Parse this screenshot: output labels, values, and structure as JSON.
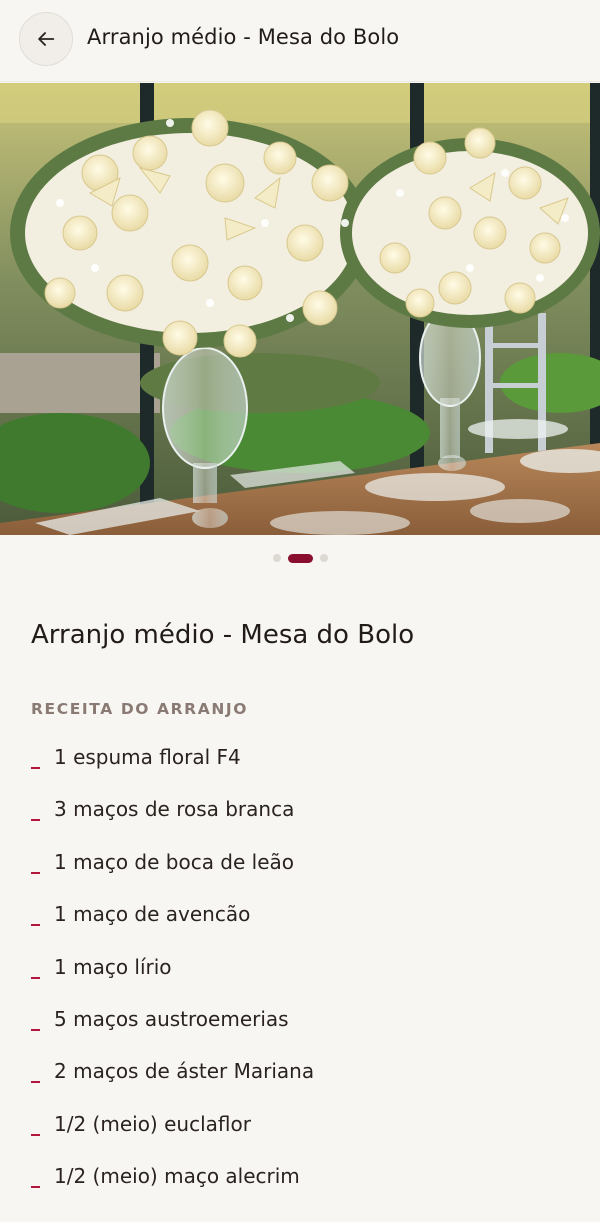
{
  "header": {
    "title": "Arranjo médio - Mesa do Bolo",
    "back_icon": "arrow-left-icon"
  },
  "gallery": {
    "image_description_icon": "photo",
    "slides": 3,
    "active_index": 1
  },
  "content": {
    "title": "Arranjo médio - Mesa do Bolo",
    "section_label": "RECEITA DO ARRANJO",
    "ingredients": [
      "1 espuma floral F4",
      "3 maços de rosa branca",
      "1 maço de boca de leão",
      "1 maço de avencão",
      "1 maço lírio",
      "5 maços austroemerias",
      "2 maços de áster Mariana",
      "1/2 (meio) euclaflor",
      "1/2 (meio) maço alecrim"
    ]
  },
  "colors": {
    "accent": "#8a0f2e",
    "bullet": "#b3163d",
    "background": "#f8f6f2",
    "muted_label": "#8a7a74"
  }
}
